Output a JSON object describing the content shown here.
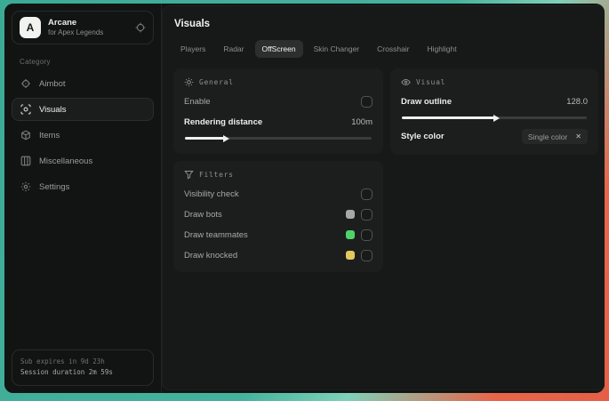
{
  "colors": {
    "background_teal": "#3cab96",
    "background_orange": "#e8654a",
    "window_bg": "#131514",
    "panel_bg": "#1c1e1d",
    "accent_white": "#f0f0ee",
    "swatch_bots": "#a8a8a8",
    "swatch_teammates": "#4ed36a",
    "swatch_knocked": "#e5c85c"
  },
  "sidebar": {
    "app": {
      "logo_letter": "A",
      "name": "Arcane",
      "subtitle": "for Apex Legends"
    },
    "category_label": "Category",
    "items": [
      {
        "label": "Aimbot",
        "icon": "crosshair-icon"
      },
      {
        "label": "Visuals",
        "icon": "eye-scan-icon"
      },
      {
        "label": "Items",
        "icon": "box-icon"
      },
      {
        "label": "Miscellaneous",
        "icon": "layout-icon"
      },
      {
        "label": "Settings",
        "icon": "gear-icon"
      }
    ],
    "active_item": "Visuals",
    "footer": {
      "sub_expires": "Sub expires in 9d 23h",
      "session_duration": "Session duration 2m 59s"
    }
  },
  "main": {
    "title": "Visuals",
    "tabs": [
      {
        "label": "Players"
      },
      {
        "label": "Radar"
      },
      {
        "label": "OffScreen"
      },
      {
        "label": "Skin Changer"
      },
      {
        "label": "Crosshair"
      },
      {
        "label": "Highlight"
      }
    ],
    "active_tab": "OffScreen",
    "general": {
      "title": "General",
      "enable_label": "Enable",
      "enable_checked": false,
      "rendering_distance_label": "Rendering distance",
      "rendering_distance_value": "100m",
      "rendering_distance_percent": 21
    },
    "visual": {
      "title": "Visual",
      "draw_outline_label": "Draw outline",
      "draw_outline_value": "128.0",
      "draw_outline_percent": 50,
      "style_color_label": "Style color",
      "style_color_value": "Single color",
      "style_color_remove_glyph": "✕"
    },
    "filters": {
      "title": "Filters",
      "rows": [
        {
          "label": "Visibility check",
          "checked": false
        },
        {
          "label": "Draw bots",
          "swatch": "#a8a8a8",
          "checked": false
        },
        {
          "label": "Draw teammates",
          "swatch": "#4ed36a",
          "checked": false
        },
        {
          "label": "Draw knocked",
          "swatch": "#e5c85c",
          "checked": false
        }
      ]
    }
  }
}
